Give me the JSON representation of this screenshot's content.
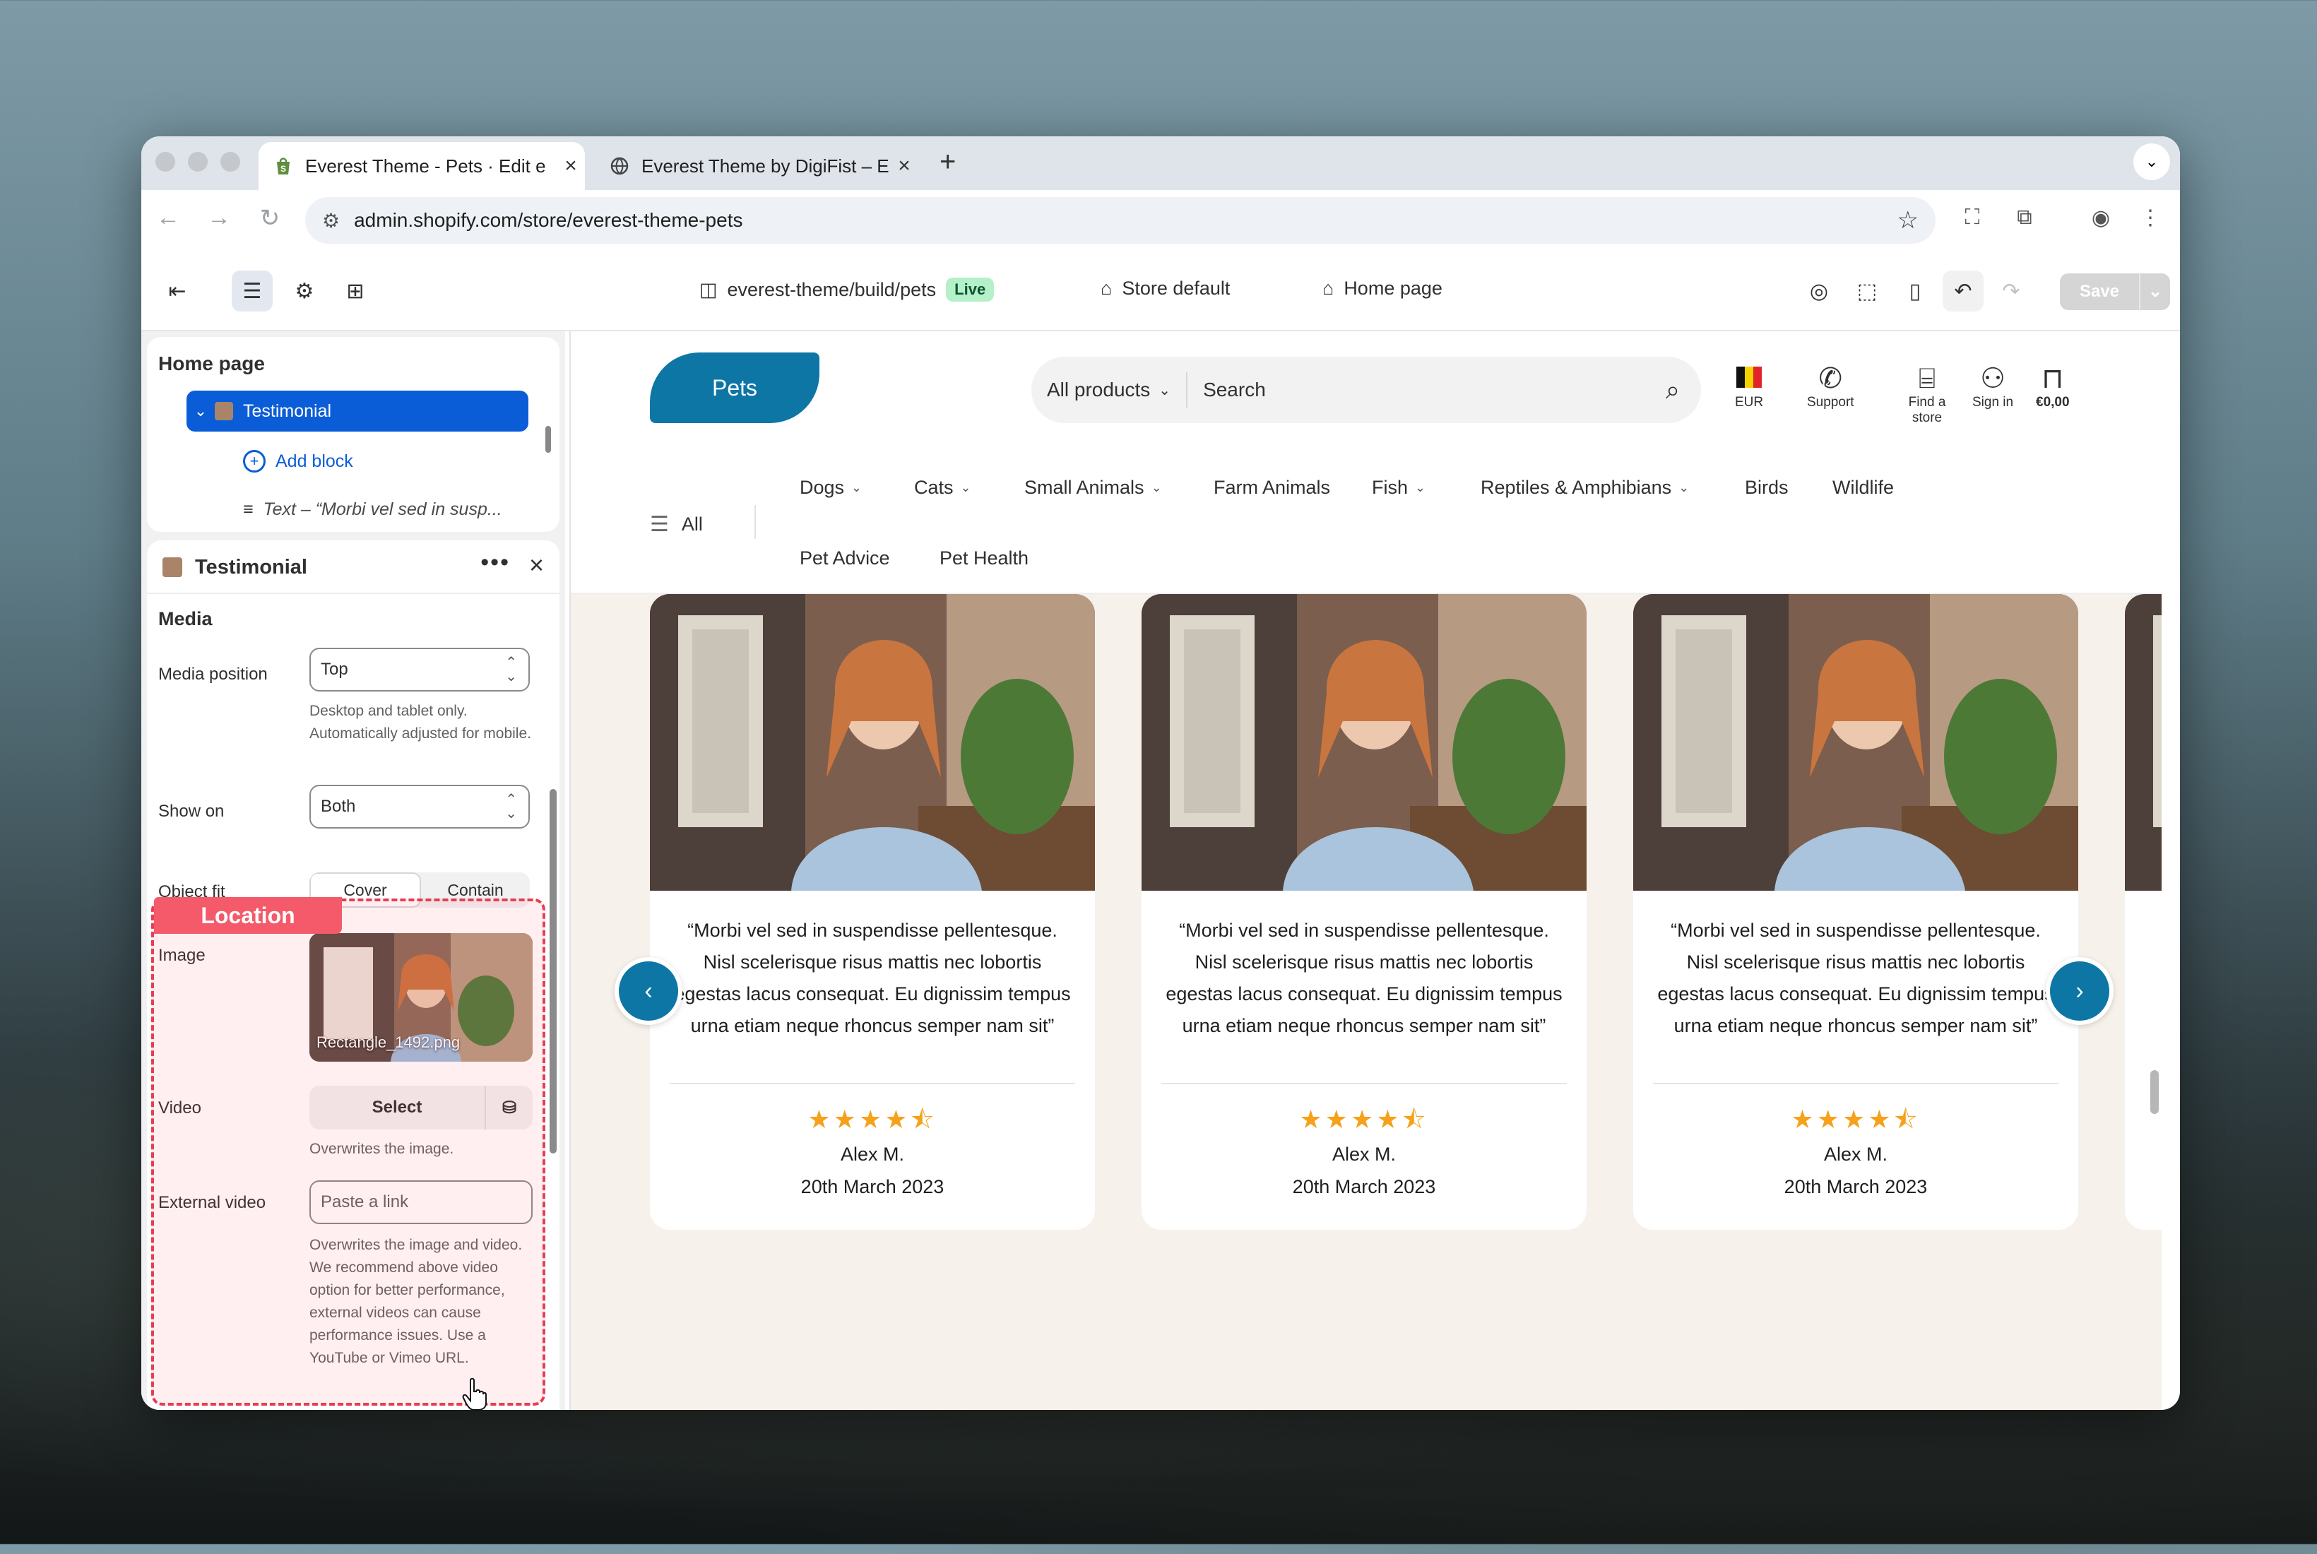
{
  "browser": {
    "tabs": [
      {
        "title": "Everest Theme - Pets · Edit e",
        "active": true
      },
      {
        "title": "Everest Theme by DigiFist – E",
        "active": false
      }
    ],
    "new_tab": "+",
    "url": "admin.shopify.com/store/everest-theme-pets"
  },
  "editor": {
    "theme_path": "everest-theme/build/pets",
    "live_badge": "Live",
    "store_context": "Store default",
    "page_selector": "Home page",
    "save_label": "Save"
  },
  "sidebar": {
    "page_title": "Home page",
    "tree": {
      "selected": "Testimonial",
      "add_block": "Add block",
      "child_text": "Text – “Morbi vel sed in susp..."
    },
    "settings": {
      "title": "Testimonial",
      "section": "Media",
      "media_position": {
        "label": "Media position",
        "value": "Top",
        "help": "Desktop and tablet only. Automatically adjusted for mobile."
      },
      "show_on": {
        "label": "Show on",
        "value": "Both"
      },
      "object_fit": {
        "label": "Object fit",
        "options": [
          "Cover",
          "Contain"
        ],
        "selected": "Cover"
      },
      "image": {
        "label": "Image",
        "filename": "Rectangle_1492.png"
      },
      "video": {
        "label": "Video",
        "button": "Select",
        "help": "Overwrites the image."
      },
      "external_video": {
        "label": "External video",
        "placeholder": "Paste a link",
        "help": "Overwrites the image and video. We recommend above video option for better performance, external videos can cause performance issues. Use a YouTube or Vimeo URL."
      }
    },
    "annotation": "Location"
  },
  "storefront": {
    "logo": "Pets",
    "search_category": "All products",
    "search_placeholder": "Search",
    "header_icons": {
      "currency": "EUR",
      "support": "Support",
      "find_store": "Find a store",
      "sign_in": "Sign in",
      "cart": "€0,00"
    },
    "nav_all": "All",
    "nav": [
      {
        "label": "Dogs",
        "dropdown": true
      },
      {
        "label": "Cats",
        "dropdown": true
      },
      {
        "label": "Small Animals",
        "dropdown": true
      },
      {
        "label": "Farm Animals",
        "dropdown": false
      },
      {
        "label": "Fish",
        "dropdown": true
      },
      {
        "label": "Reptiles & Amphibians",
        "dropdown": true
      },
      {
        "label": "Birds",
        "dropdown": false
      },
      {
        "label": "Wildlife",
        "dropdown": false
      },
      {
        "label": "Pet Advice",
        "dropdown": false
      },
      {
        "label": "Pet Health",
        "dropdown": false
      }
    ],
    "testimonials": [
      {
        "quote": "“Morbi vel sed in suspendisse pellentesque. Nisl scelerisque risus mattis nec lobortis egestas lacus consequat. Eu dignissim tempus urna etiam neque rhoncus semper nam sit”",
        "rating": 4.5,
        "author": "Alex M.",
        "date": "20th March 2023"
      },
      {
        "quote": "“Morbi vel sed in suspendisse pellentesque. Nisl scelerisque risus mattis nec lobortis egestas lacus consequat. Eu dignissim tempus urna etiam neque rhoncus semper nam sit”",
        "rating": 4.5,
        "author": "Alex M.",
        "date": "20th March 2023"
      },
      {
        "quote": "“Morbi vel sed in suspendisse pellentesque. Nisl scelerisque risus mattis nec lobortis egestas lacus consequat. Eu dignissim tempus urna etiam neque rhoncus semper nam sit”",
        "rating": 4.5,
        "author": "Alex M.",
        "date": "20th March 2023"
      }
    ],
    "carousel_progress": 0.2
  },
  "colors": {
    "accent": "#0d76a5",
    "shopify_blue": "#0b5dd7",
    "star": "#f5a11a",
    "annotation": "#f45a6a"
  }
}
